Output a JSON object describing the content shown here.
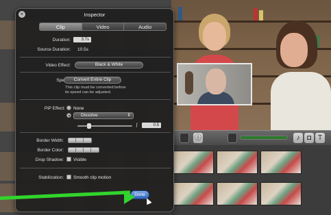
{
  "inspector": {
    "title": "Inspector",
    "close_icon": "close-icon",
    "tabs": [
      {
        "label": "Clip",
        "active": true
      },
      {
        "label": "Video",
        "active": false
      },
      {
        "label": "Audio",
        "active": false
      }
    ],
    "duration_label": "Duration:",
    "duration_value": "3.7s",
    "source_duration_label": "Source Duration:",
    "source_duration_value": "10.5s",
    "video_effect_label": "Video Effect:",
    "video_effect_value": "Black & White",
    "speed_label": "Speed:",
    "speed_button": "Convert Entire Clip",
    "speed_note_1": "This clip must be converted before",
    "speed_note_2": "its speed can be adjusted.",
    "pip_effect_label": "PiP Effect:",
    "pip_option_none": "None",
    "pip_option_dissolve": "Dissolve",
    "pip_duration_value": "0.5",
    "border_width_label": "Border Width:",
    "border_color_label": "Border Color:",
    "drop_shadow_label": "Drop Shadow:",
    "drop_shadow_option": "Visible",
    "stabilization_label": "Stabilization:",
    "stabilization_option": "Smooth clip motion",
    "done_button": "Done"
  },
  "colors": {
    "arrow": "#31d52c",
    "done_button": "#2f63bd",
    "panel": "#1e1e1e"
  }
}
